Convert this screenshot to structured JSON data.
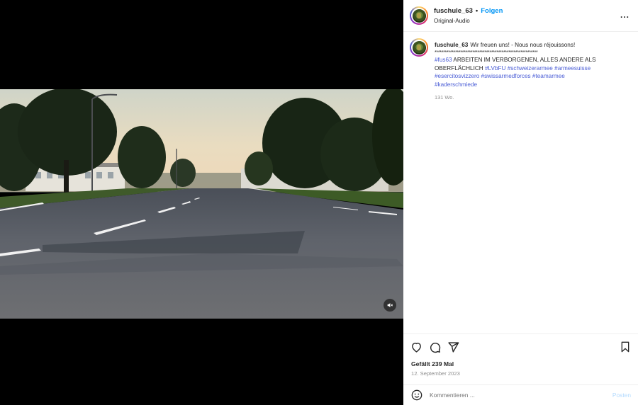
{
  "header": {
    "username": "fuschule_63",
    "separator": "•",
    "follow_label": "Folgen",
    "audio_label": "Original-Audio",
    "more_label": "..."
  },
  "media": {
    "type": "video",
    "muted_icon": "speaker-muted-icon"
  },
  "caption": {
    "username": "fuschule_63",
    "text_intro": "Wir freuen uns! - Nous nous réjouissons!",
    "stars": "************************************************************",
    "tag_fus63": "#fus63",
    "text_mid": " ARBEITEN IM VERBORGENEN, ALLES ANDERE ALS OBERFLÄCHLICH ",
    "tag_lvbfu": "#LVbFU",
    "tag_schweizerarmee": "#schweizerarmee",
    "tag_armeesuisse": "#armeesuisse",
    "tag_esercitosvizzero": "#esercitosvizzero",
    "tag_swissarmedforces": "#swissarmedforces",
    "tag_teamarmee": "#teamarmee",
    "tag_kaderschmiede": "#kaderschmiede",
    "age": "131 Wo."
  },
  "actions": {
    "like_icon": "heart-icon",
    "comment_icon": "comment-icon",
    "share_icon": "send-icon",
    "save_icon": "bookmark-icon",
    "likes_text": "Gefällt 239 Mal",
    "date_text": "12. September 2023"
  },
  "comment": {
    "emoji_icon": "smiley-icon",
    "placeholder": "Kommentieren ...",
    "post_label": "Posten",
    "post_color": "#b3dbff"
  },
  "colors": {
    "link_blue": "#0095f6",
    "hashtag_blue": "#4a5dd6",
    "muted_text": "#8e8e8e"
  }
}
